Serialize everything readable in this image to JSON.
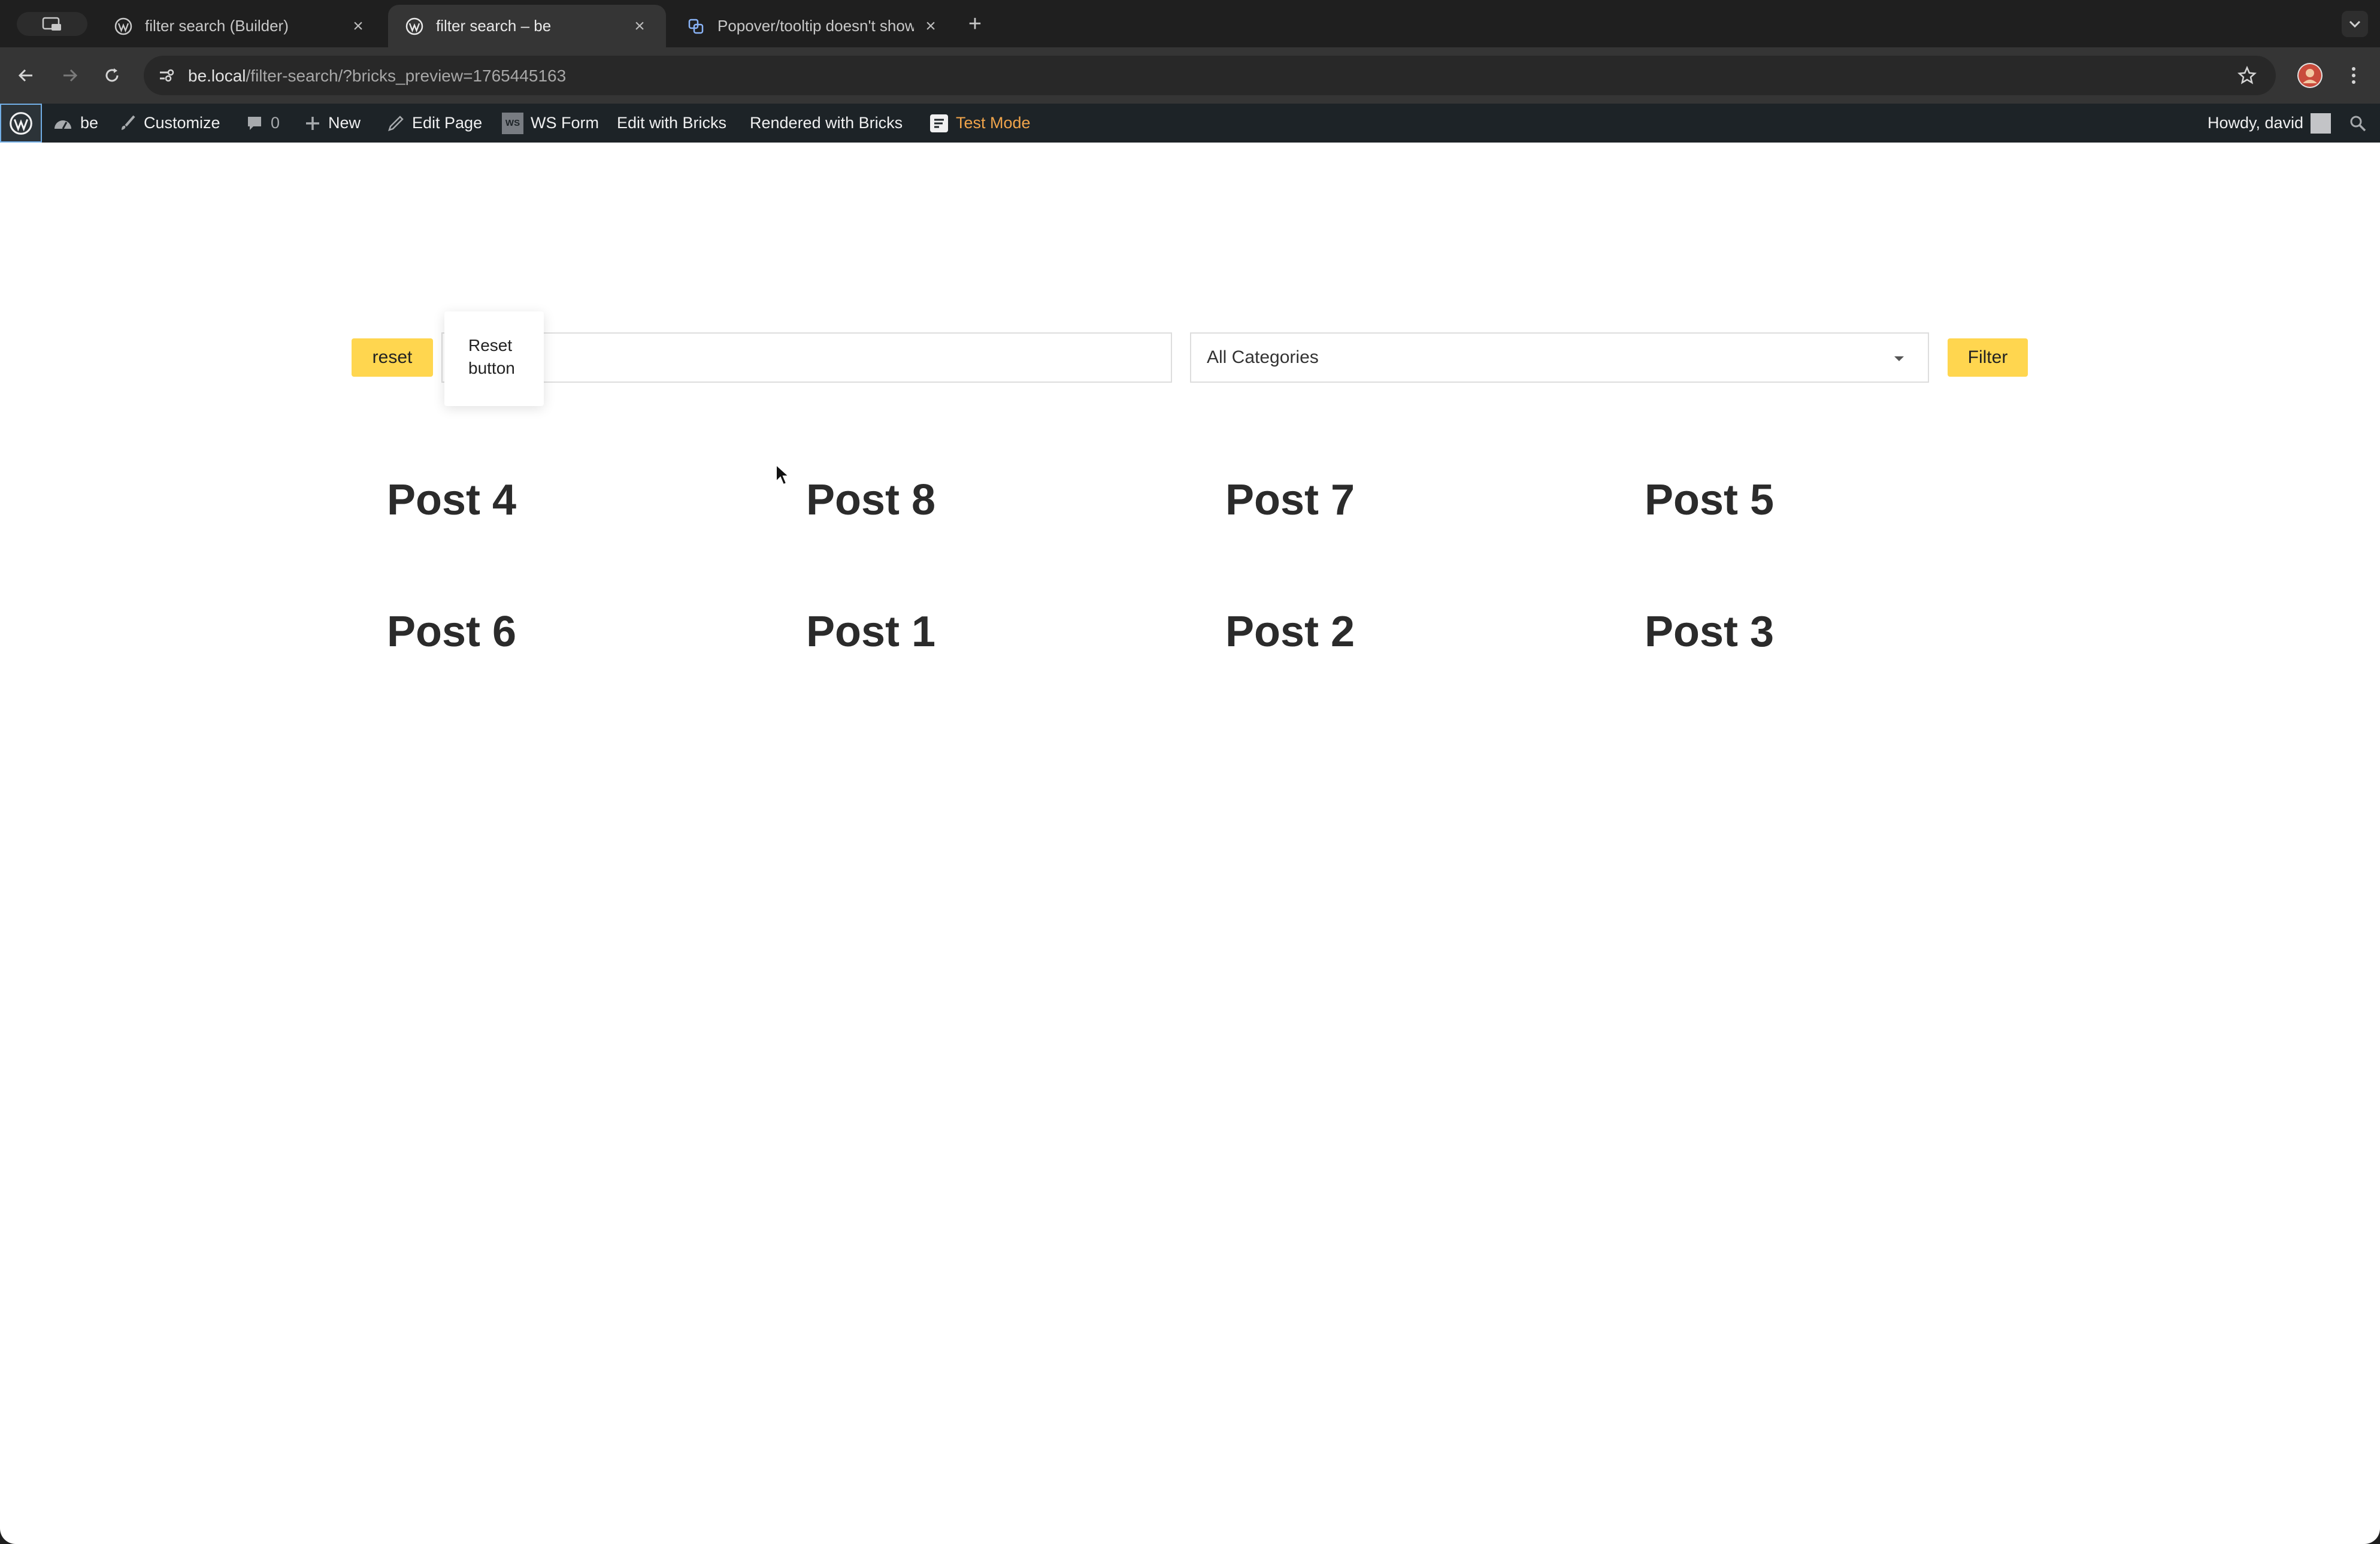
{
  "browser": {
    "tabs": [
      {
        "title": "filter search (Builder)",
        "active": false,
        "favicon": "wordpress-icon"
      },
      {
        "title": "filter search – be",
        "active": true,
        "favicon": "wordpress-icon"
      },
      {
        "title": "Popover/tooltip doesn't show",
        "active": false,
        "favicon": "forum-icon"
      }
    ],
    "url_host": "be.local",
    "url_path": "/filter-search/?bricks_preview=1765445163"
  },
  "adminbar": {
    "site_name": "be",
    "customize": "Customize",
    "comments_count": "0",
    "new": "New",
    "edit_page": "Edit Page",
    "ws_form": "WS Form",
    "ws_badge": "WS",
    "edit_with_bricks": "Edit with Bricks",
    "rendered_with_bricks": "Rendered with Bricks",
    "test_mode": "Test Mode",
    "howdy": "Howdy, david"
  },
  "filters": {
    "reset_label": "reset",
    "tooltip_line1": "Reset",
    "tooltip_line2": "button",
    "category_selected": "All Categories",
    "filter_label": "Filter"
  },
  "posts": [
    "Post 4",
    "Post 8",
    "Post 7",
    "Post 5",
    "Post 6",
    "Post 1",
    "Post 2",
    "Post 3"
  ],
  "colors": {
    "accent": "#ffd64f",
    "adminbar_bg": "#1d2327",
    "test_mode": "#f0a44b"
  }
}
